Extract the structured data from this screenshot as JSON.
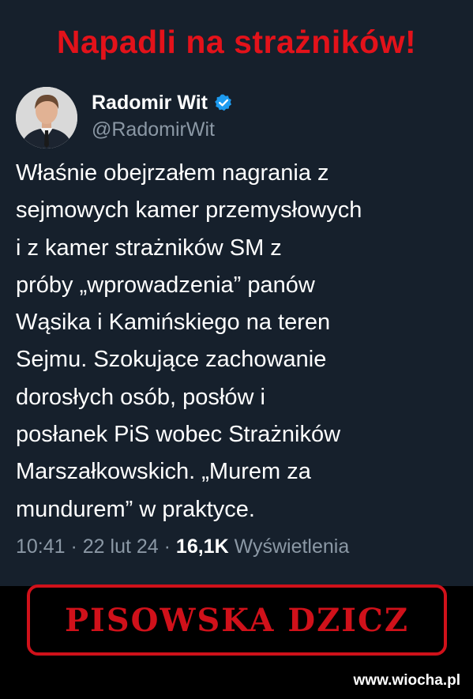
{
  "headline": "Napadli na strażników!",
  "tweet": {
    "author_name": "Radomir Wit",
    "handle": "@RadomirWit",
    "text": "Właśnie obejrzałem nagrania z\nsejmowych kamer przemysłowych\ni z kamer strażników SM z\npróby „wprowadzenia” panów\nWąsika i Kamińskiego na teren\nSejmu. Szokujące zachowanie\ndorosłych osób, posłów i\nposłanek PiS wobec Strażników\nMarszałkowskich. „Murem za\nmundurem” w praktyce.",
    "time": "10:41",
    "date": "22 lut 24",
    "views_count": "16,1K",
    "views_label": "Wyświetlenia",
    "separator": " · "
  },
  "stamp": "PISOWSKA DZICZ",
  "watermark": "www.wiocha.pl",
  "colors": {
    "background": "#16202c",
    "headline_red": "#e3121a",
    "stamp_red": "#d0111a",
    "verified_blue": "#1d9bf0",
    "muted_text": "#8b98a5"
  },
  "icons": {
    "verified": "verified-badge-icon"
  }
}
